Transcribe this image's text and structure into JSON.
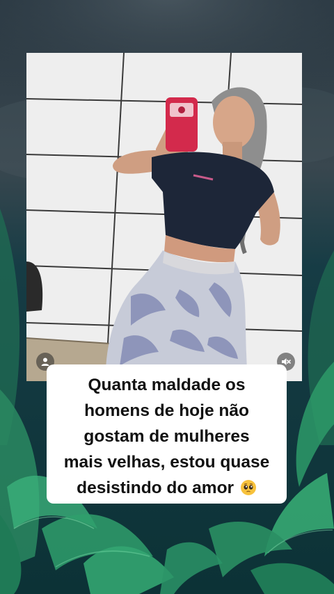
{
  "story": {
    "caption": {
      "lines": [
        "Quanta maldade os",
        "homens de hoje não",
        "gostam de mulheres",
        "mais velhas, estou quase",
        "desistindo do amor"
      ],
      "emoji": "pleading-face-icon"
    },
    "controls": {
      "tag_icon": "person-tag-icon",
      "mute_icon": "speaker-muted-icon"
    },
    "colors": {
      "background_top": "#2b3a44",
      "background_bottom": "#0f3a3c",
      "leaf_green": "#2fae74",
      "caption_bg": "#ffffff",
      "caption_text": "#111111"
    }
  }
}
